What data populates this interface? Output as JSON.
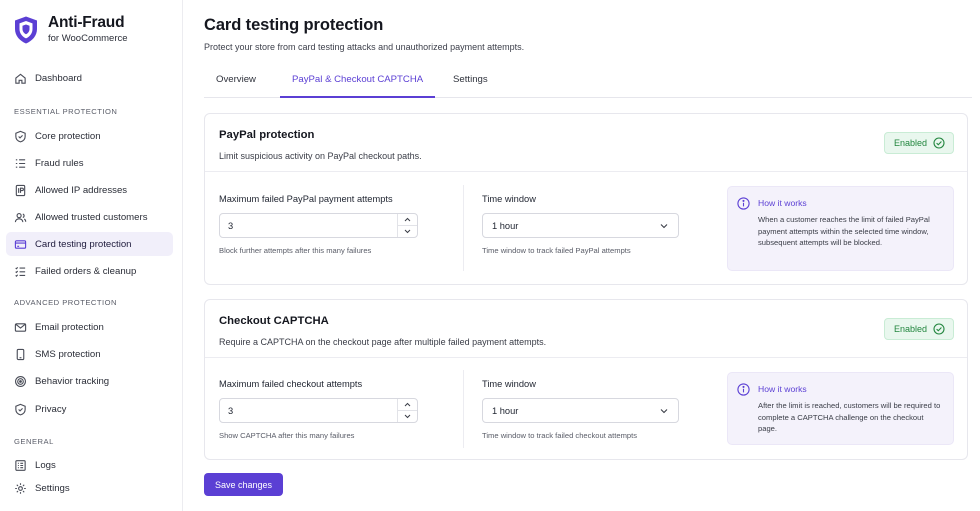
{
  "brand": {
    "title": "Anti-Fraud",
    "subtitle": "for WooCommerce",
    "accent": "#5b3fd4"
  },
  "sidebar": {
    "dashboard": {
      "label": "Dashboard",
      "icon": "home-icon"
    },
    "sections": [
      {
        "heading": "ESSENTIAL PROTECTION",
        "items": [
          {
            "label": "Core protection",
            "icon": "shield-icon"
          },
          {
            "label": "Fraud rules",
            "icon": "list-icon"
          },
          {
            "label": "Allowed IP addresses",
            "icon": "ip-icon"
          },
          {
            "label": "Allowed trusted customers",
            "icon": "users-icon"
          },
          {
            "label": "Card testing protection",
            "icon": "credit-card-icon",
            "active": true
          },
          {
            "label": "Failed orders & cleanup",
            "icon": "checklist-icon"
          }
        ]
      },
      {
        "heading": "ADVANCED PROTECTION",
        "items": [
          {
            "label": "Email protection",
            "icon": "mail-icon"
          },
          {
            "label": "SMS protection",
            "icon": "phone-icon"
          },
          {
            "label": "Behavior tracking",
            "icon": "target-icon"
          },
          {
            "label": "Privacy",
            "icon": "shield-check-icon"
          }
        ]
      },
      {
        "heading": "GENERAL",
        "items": [
          {
            "label": "Logs",
            "icon": "log-icon"
          },
          {
            "label": "Settings",
            "icon": "gear-icon"
          }
        ]
      }
    ]
  },
  "page": {
    "title": "Card testing protection",
    "subtitle": "Protect your store from card testing attacks and unauthorized payment attempts."
  },
  "tabs": [
    {
      "label": "Overview",
      "active": false
    },
    {
      "label": "PayPal & Checkout CAPTCHA",
      "active": true
    },
    {
      "label": "Settings",
      "active": false
    }
  ],
  "paypal": {
    "title": "PayPal protection",
    "description": "Limit suspicious activity on PayPal checkout paths.",
    "status": "Enabled",
    "attempts_label": "Maximum failed PayPal payment attempts",
    "attempts_value": "3",
    "attempts_help": "Block further attempts after this many failures",
    "window_label": "Time window",
    "window_value": "1 hour",
    "window_help": "Time window to track failed PayPal attempts",
    "info_title": "How it works",
    "info_text": "When a customer reaches the limit of failed PayPal payment attempts within the selected time window, subsequent attempts will be blocked."
  },
  "captcha": {
    "title": "Checkout CAPTCHA",
    "description": "Require a CAPTCHA on the checkout page after multiple failed payment attempts.",
    "status": "Enabled",
    "attempts_label": "Maximum failed checkout attempts",
    "attempts_value": "3",
    "attempts_help": "Show CAPTCHA after this many failures",
    "window_label": "Time window",
    "window_value": "1 hour",
    "window_help": "Time window to track failed checkout attempts",
    "info_title": "How it works",
    "info_text": "After the limit is reached, customers will be required to complete a CAPTCHA challenge on the checkout page."
  },
  "actions": {
    "save_label": "Save changes"
  },
  "colors": {
    "accent": "#5b3fd4",
    "enabled": "#23863f",
    "enabled_bg": "#e9f7ee",
    "info_bg": "#f4f2fb"
  }
}
